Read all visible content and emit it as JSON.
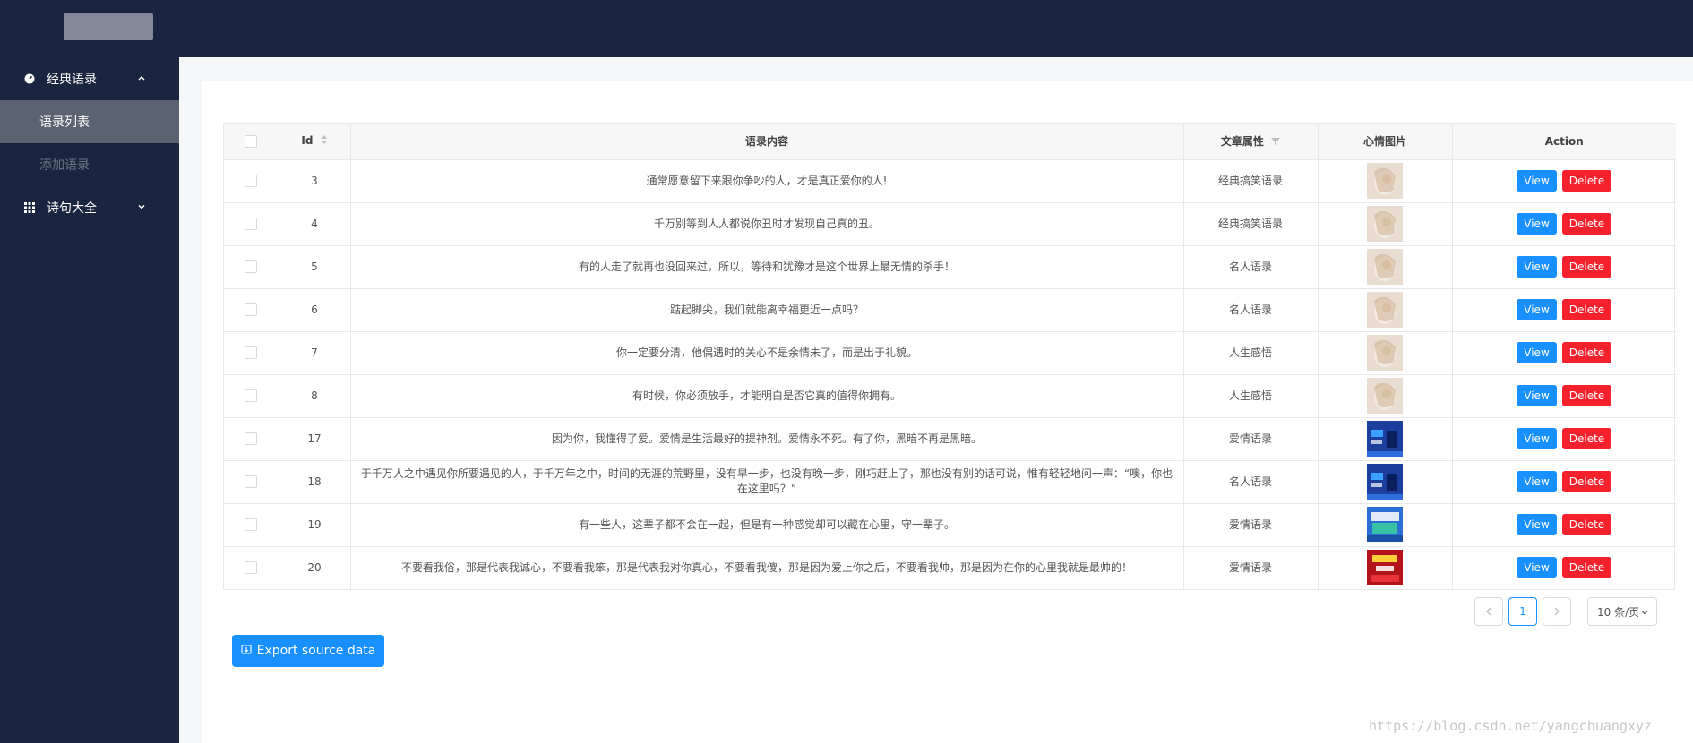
{
  "sidebar": {
    "group1": {
      "label": "经典语录",
      "icon": "dashboard-icon"
    },
    "items": [
      {
        "label": "语录列表",
        "active": true
      },
      {
        "label": "添加语录",
        "active": false
      }
    ],
    "group2": {
      "label": "诗句大全",
      "icon": "grid-icon"
    }
  },
  "table": {
    "headers": {
      "id": "Id",
      "content": "语录内容",
      "category": "文章属性",
      "image": "心情图片",
      "action": "Action"
    },
    "rows": [
      {
        "id": "3",
        "content": "通常愿意留下来跟你争吵的人，才是真正爱你的人!",
        "category": "经典搞笑语录",
        "thumb": "photo"
      },
      {
        "id": "4",
        "content": "千万别等到人人都说你丑时才发现自己真的丑。",
        "category": "经典搞笑语录",
        "thumb": "photo"
      },
      {
        "id": "5",
        "content": "有的人走了就再也没回来过，所以，等待和犹豫才是这个世界上最无情的杀手！",
        "category": "名人语录",
        "thumb": "photo"
      },
      {
        "id": "6",
        "content": "踮起脚尖，我们就能离幸福更近一点吗？",
        "category": "名人语录",
        "thumb": "photo"
      },
      {
        "id": "7",
        "content": "你一定要分清，他偶遇时的关心不是余情未了，而是出于礼貌。",
        "category": "人生感悟",
        "thumb": "photo"
      },
      {
        "id": "8",
        "content": "有时候，你必须放手，才能明白是否它真的值得你拥有。",
        "category": "人生感悟",
        "thumb": "photo"
      },
      {
        "id": "17",
        "content": "因为你，我懂得了爱。爱情是生活最好的提神剂。爱情永不死。有了你，黑暗不再是黑暗。",
        "category": "爱情语录",
        "thumb": "blue"
      },
      {
        "id": "18",
        "content": "于千万人之中遇见你所要遇见的人，于千万年之中，时间的无涯的荒野里，没有早一步，也没有晚一步，刚巧赶上了，那也没有别的话可说，惟有轻轻地问一声：“噢，你也在这里吗？”",
        "category": "名人语录",
        "thumb": "blue"
      },
      {
        "id": "19",
        "content": "有一些人，这辈子都不会在一起，但是有一种感觉却可以藏在心里，守一辈子。",
        "category": "爱情语录",
        "thumb": "poster"
      },
      {
        "id": "20",
        "content": "不要看我俗，那是代表我诚心，不要看我笨，那是代表我对你真心，不要看我傻，那是因为爱上你之后，不要看我帅，那是因为在你的心里我就是最帅的！",
        "category": "爱情语录",
        "thumb": "red"
      }
    ],
    "view_label": "View",
    "delete_label": "Delete"
  },
  "pagination": {
    "current_page": "1",
    "page_size": "10 条/页"
  },
  "export_label": "Export source data",
  "watermark": "https://blog.csdn.net/yangchuangxyz",
  "colors": {
    "primary": "#1890ff",
    "danger": "#f5222d",
    "sidebar_bg": "#1a2540"
  }
}
